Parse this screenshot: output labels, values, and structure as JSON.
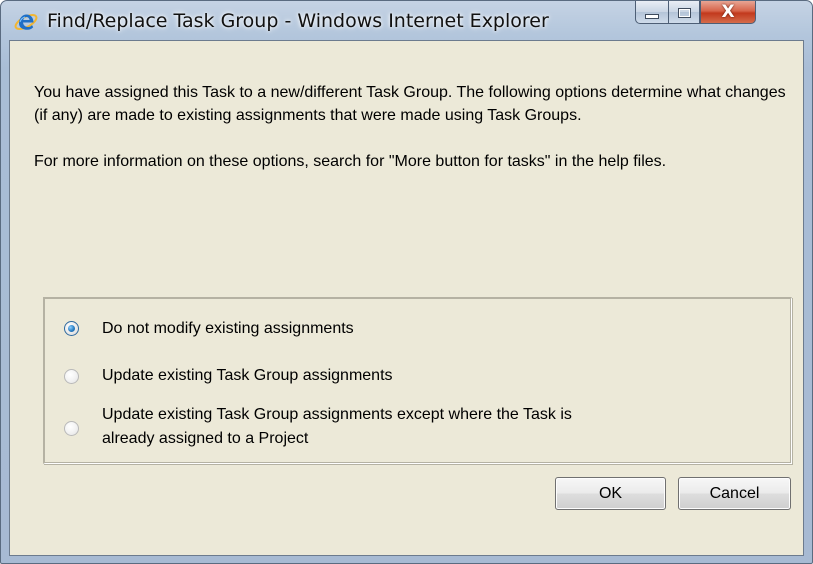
{
  "window": {
    "title": "Find/Replace Task Group - Windows Internet Explorer",
    "app_icon": "internet-explorer-icon",
    "minimize_icon": "minimize-icon",
    "maximize_icon": "maximize-icon",
    "close_icon": "close-icon",
    "close_glyph": "X"
  },
  "dialog": {
    "message_paragraph_1": "You have assigned this Task to a new/different Task Group. The following options determine what changes (if any) are made to existing assignments that were made using Task Groups.",
    "message_paragraph_2": "For more information on these options, search for \"More button for tasks\" in the help files.",
    "options": [
      {
        "label": "Do not modify existing assignments",
        "selected": true
      },
      {
        "label": "Update existing Task Group assignments",
        "selected": false
      },
      {
        "label_line_1": "Update existing Task Group assignments except where the Task is",
        "label_line_2": "already assigned to a Project",
        "selected": false
      }
    ],
    "ok_label": "OK",
    "cancel_label": "Cancel"
  },
  "colors": {
    "dialog_background": "#ece9d8",
    "frame": "#a9bdd6",
    "close_button": "#c2391d",
    "radio_selected": "#2a7fc4"
  }
}
